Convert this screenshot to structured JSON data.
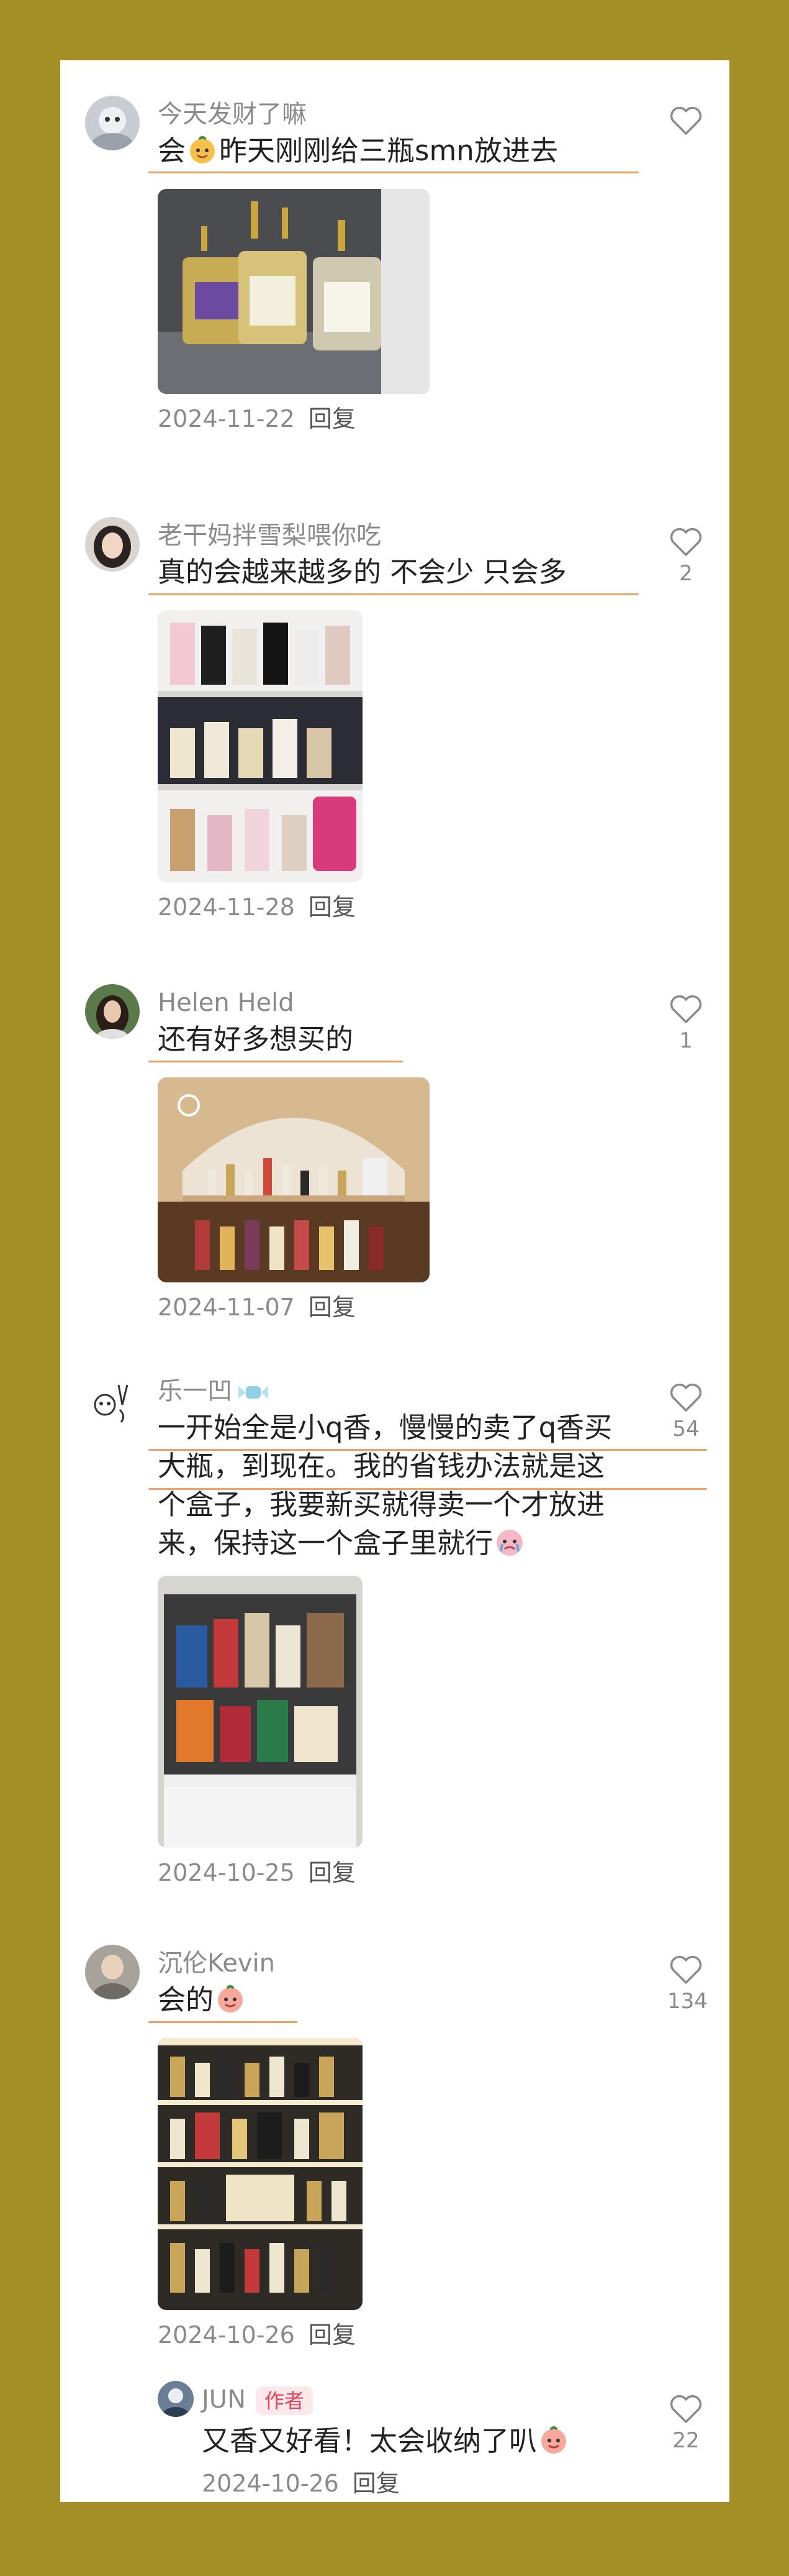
{
  "colors": {
    "background": "#a48e26",
    "card": "#ffffff",
    "username": "#8a8a8a",
    "text": "#222222",
    "underline": "#f0a060",
    "author_badge": "#e8455a"
  },
  "comments": [
    {
      "username": "今天发财了嘛",
      "text_before": "会",
      "emoji": "peach-face-emoji",
      "text_after": "昨天刚刚给三瓶smn放进去",
      "date": "2024-11-22",
      "reply_label": "回复",
      "likes": "",
      "photo": "perfume-bottles-photo"
    },
    {
      "username": "老干妈拌雪梨喂你吃",
      "text": "真的会越来越多的 不会少 只会多",
      "date": "2024-11-28",
      "reply_label": "回复",
      "likes": "2",
      "photo": "perfume-shelf-photo"
    },
    {
      "username": "Helen Held",
      "text": "还有好多想买的",
      "date": "2024-11-07",
      "reply_label": "回复",
      "likes": "1",
      "photo": "arched-perfume-cabinet-photo"
    },
    {
      "username": "乐一凹",
      "line1": "一开始全是小q香，慢慢的卖了q香买",
      "line2": "大瓶，到现在。我的省钱办法就是这",
      "line3": "个盒子，我要新买就得卖一个才放进",
      "line4": "来，保持这一个盒子里就行",
      "emoji": "crying-face-emoji",
      "date": "2024-10-25",
      "reply_label": "回复",
      "likes": "54",
      "photo": "perfume-box-photo"
    },
    {
      "username": "沉伦Kevin",
      "text": "会的",
      "emoji": "peach-face-emoji",
      "date": "2024-10-26",
      "reply_label": "回复",
      "likes": "134",
      "photo": "lit-perfume-cabinet-photo"
    }
  ],
  "reply": {
    "username": "JUN",
    "badge": "作者",
    "text": "又香又好看！太会收纳了叭",
    "emoji": "peach-face-emoji",
    "date": "2024-10-26",
    "reply_label": "回复",
    "likes": "22"
  }
}
